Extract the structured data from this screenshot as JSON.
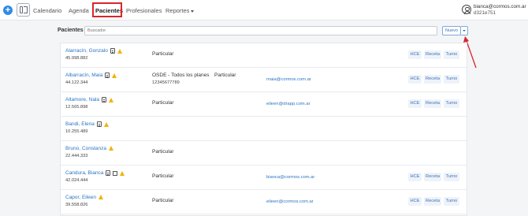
{
  "nav": {
    "items": [
      "Calendario",
      "Agenda",
      "Pacientes",
      "Profesionales",
      "Reportes"
    ],
    "active": "Pacientes"
  },
  "user": {
    "email": "bianca@cormos.com.ar",
    "id": "d321e751"
  },
  "filter": {
    "label": "Pacientes",
    "search_placeholder": "Buscador",
    "new_button": "Nuevo"
  },
  "actions": {
    "hce": "HCE",
    "receta": "Receta",
    "turno": "Turno"
  },
  "patients": [
    {
      "name": "Alarracín, Gonzalo",
      "doc": "45.998.882",
      "plan": "Particular",
      "plan_type": "",
      "plan_no": "",
      "email": "",
      "icons": [
        "card-icon",
        "warning-icon"
      ]
    },
    {
      "name": "Albarracín, Maia",
      "doc": "44.122.344",
      "plan": "OSDE - Todos los planes",
      "plan_type": "Particular",
      "plan_no": "12345677789",
      "email": "maia@cormos.com.ar",
      "icons": [
        "card-icon",
        "warning-icon"
      ]
    },
    {
      "name": "Altamore, Nala",
      "doc": "12.565.898",
      "plan": "Particular",
      "plan_type": "",
      "plan_no": "",
      "email": "eileen@drapp.com.ar",
      "icons": [
        "card-icon",
        "warning-icon"
      ]
    },
    {
      "name": "Bandi, Elena",
      "doc": "10.255.489",
      "plan": "",
      "plan_type": "",
      "plan_no": "",
      "email": "",
      "icons": [
        "card-icon",
        "warning-icon"
      ]
    },
    {
      "name": "Bruno, Constanza",
      "doc": "22.444.333",
      "plan": "Particular",
      "plan_type": "",
      "plan_no": "",
      "email": "",
      "icons": [
        "warning-icon"
      ]
    },
    {
      "name": "Candura, Bianca",
      "doc": "42.024.444",
      "plan": "Particular",
      "plan_type": "",
      "plan_no": "",
      "email": "bianca@cormos.com.ar",
      "icons": [
        "card-icon",
        "image-icon",
        "warning-icon"
      ]
    },
    {
      "name": "Capor, Eileen",
      "doc": "39.558.826",
      "plan": "Particular",
      "plan_type": "",
      "plan_no": "",
      "email": "eileen@cormos.com.ar",
      "icons": [
        "warning-icon"
      ]
    }
  ],
  "colors": {
    "accent": "#2e8be6",
    "link": "#2a75c4",
    "highlight": "#d9252b",
    "warning": "#f0b400"
  }
}
